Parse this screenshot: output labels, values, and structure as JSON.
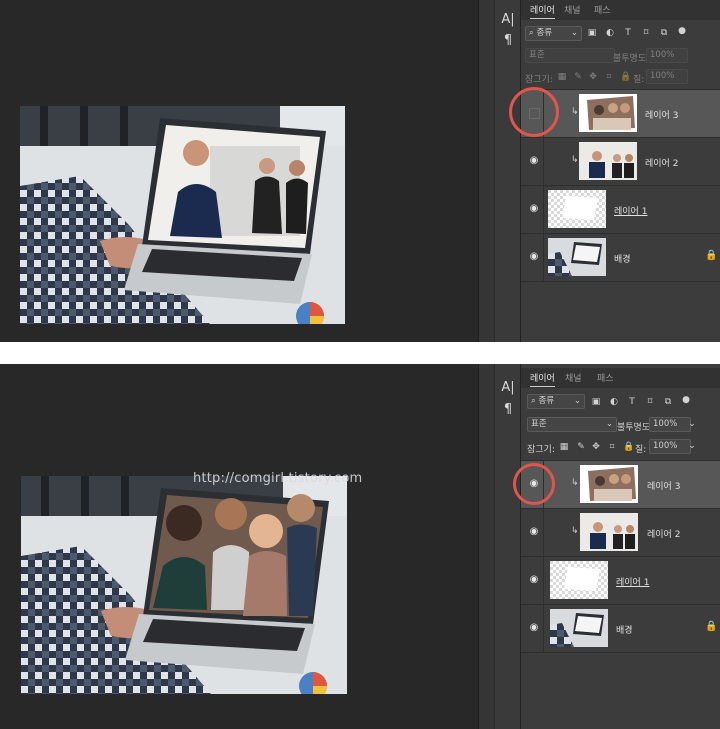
{
  "panel_tabs": {
    "layers": "레이어",
    "channels": "채널",
    "paths": "패스"
  },
  "filter_select": "종류",
  "blend_mode": "표준",
  "opacity_label": "불투명도:",
  "opacity_value": "100%",
  "lock_label": "잠그기:",
  "fill_label": "칠:",
  "fill_value": "100%",
  "layers": [
    {
      "name": "레이어 3",
      "visible_top": false,
      "visible_bottom": true,
      "clipped": true,
      "selected": true
    },
    {
      "name": "레이어 2",
      "visible": true,
      "clipped": true
    },
    {
      "name": "레이어 1",
      "visible": true,
      "clipped": false
    },
    {
      "name": "배경",
      "visible": true,
      "clipped": false,
      "locked": true
    }
  ],
  "watermark": "http://comgirl.tistory.com",
  "side_icons": [
    "character-icon",
    "paragraph-icon"
  ],
  "colors": {
    "highlight_ring": "#e2554a",
    "panel_bg": "#3c3c3c",
    "canvas_bg": "#282828",
    "selected_layer": "#575757"
  }
}
